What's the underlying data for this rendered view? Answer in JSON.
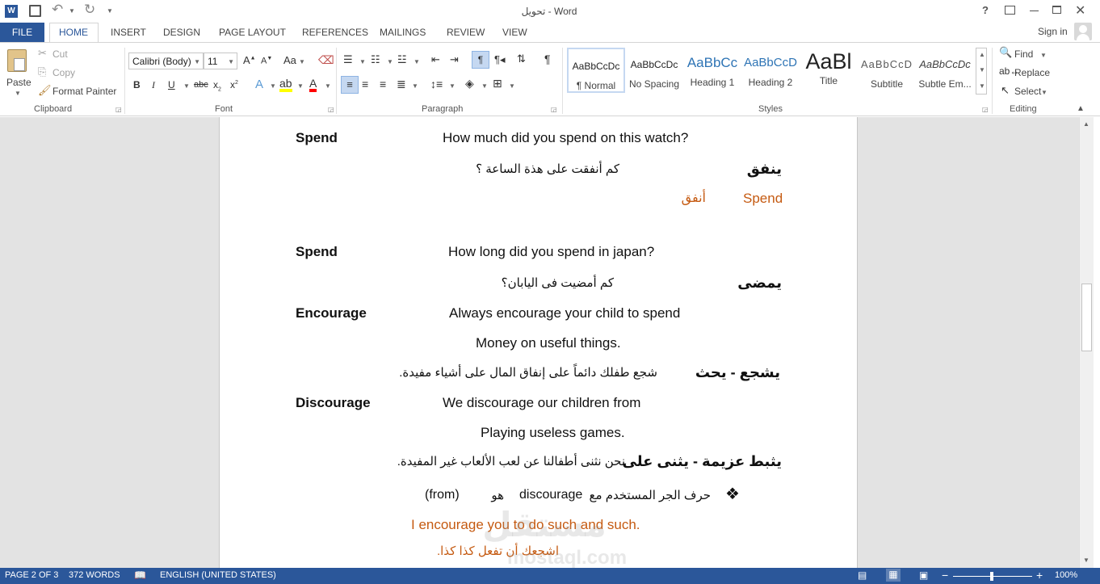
{
  "window": {
    "title": "تحويل - Word",
    "help": "?",
    "sign_in": "Sign in"
  },
  "tabs": {
    "file": "FILE",
    "items": [
      "HOME",
      "INSERT",
      "DESIGN",
      "PAGE LAYOUT",
      "REFERENCES",
      "MAILINGS",
      "REVIEW",
      "VIEW"
    ]
  },
  "ribbon": {
    "clipboard": {
      "paste": "Paste",
      "cut": "Cut",
      "copy": "Copy",
      "format_painter": "Format Painter",
      "label": "Clipboard"
    },
    "font": {
      "name": "Calibri (Body)",
      "size": "11",
      "label": "Font",
      "case": "Aa"
    },
    "paragraph": {
      "label": "Paragraph"
    },
    "styles": {
      "label": "Styles",
      "items": [
        {
          "sample": "AaBbCcDc",
          "name": "¶ Normal"
        },
        {
          "sample": "AaBbCcDc",
          "name": "No Spacing"
        },
        {
          "sample": "AaBbCc",
          "name": "Heading 1"
        },
        {
          "sample": "AaBbCcD",
          "name": "Heading 2"
        },
        {
          "sample": "AaBl",
          "name": "Title"
        },
        {
          "sample": "AaBbCcD",
          "name": "Subtitle"
        },
        {
          "sample": "AaBbCcDc",
          "name": "Subtle Em..."
        }
      ]
    },
    "editing": {
      "find": "Find",
      "replace": "Replace",
      "select": "Select",
      "label": "Editing"
    }
  },
  "document": {
    "lines": [
      {
        "t1": "Spend",
        "t2": "How much did you spend on this watch?"
      },
      {
        "ar_word": "ينفق",
        "ar_sentence": "كم أنفقت على هذة الساعة ؟"
      },
      {
        "en": "Spend",
        "ar": "أنفق"
      },
      {
        "t1": "Spend",
        "t2": "How long did you spend in japan?"
      },
      {
        "ar_word": "يمضى",
        "ar_sentence": "كم أمضيت فى اليابان؟"
      },
      {
        "t1": "Encourage",
        "t2": "Always encourage your child to spend"
      },
      {
        "t2": "Money on useful things."
      },
      {
        "ar_word": "يشجع - يحث",
        "ar_sentence": "شجع طفلك دائماً على إنفاق المال على أشياء مفيدة."
      },
      {
        "t1": "Discourage",
        "t2": "We discourage our children from"
      },
      {
        "t2": "Playing useless games."
      },
      {
        "ar_word": "يثبط عزيمة - يثنى على",
        "ar_sentence": "نحن نثنى أطفالنا عن لعب الألعاب غير المفيدة."
      },
      {
        "bullet": "❖",
        "ar": "حرف الجر المستخدم مع",
        "en_word": "discourage",
        "ar2": "هو",
        "from": "(from)"
      },
      {
        "en": "I encourage you to do such and such."
      },
      {
        "ar": "اشجعك أن تفعل كذا كذا."
      }
    ],
    "watermark": {
      "ar": "مستقل",
      "en": "mostaql.com"
    }
  },
  "status": {
    "page": "PAGE 2 OF 3",
    "words": "372 WORDS",
    "language": "ENGLISH (UNITED STATES)",
    "zoom": "100%"
  },
  "colors": {
    "accent": "#2b579a",
    "orange": "#c55a11"
  }
}
